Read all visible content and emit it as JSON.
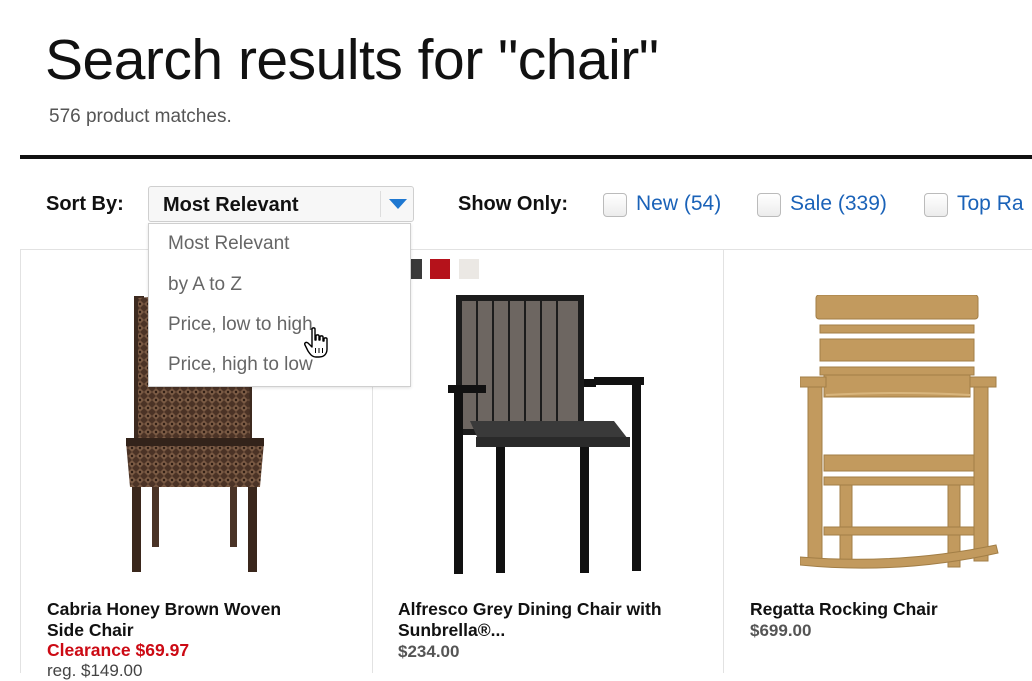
{
  "page": {
    "title": "Search results for \"chair\"",
    "match_count": "576 product matches."
  },
  "toolbar": {
    "sort_label": "Sort By:",
    "sort_selected": "Most Relevant",
    "sort_options": [
      "Most Relevant",
      "by A to Z",
      "Price, low to high",
      "Price, high to low"
    ],
    "show_label": "Show Only:",
    "filters": [
      {
        "label": "New (54)",
        "checked": false
      },
      {
        "label": "Sale (339)",
        "checked": false
      },
      {
        "label": "Top Ra",
        "checked": false
      }
    ]
  },
  "products": [
    {
      "name_line1": "Cabria Honey Brown Woven",
      "name_line2": "Side Chair",
      "clearance": "Clearance $69.97",
      "reg_price": "reg. $149.00"
    },
    {
      "name_line1": "Alfresco Grey Dining Chair with",
      "name_line2": "Sunbrella®...",
      "price": "$234.00",
      "swatch_colors": [
        "#3a3a3a",
        "#b5121b",
        "#ebe8e4"
      ]
    },
    {
      "name_line1": "Regatta Rocking Chair",
      "price": "$699.00"
    }
  ],
  "colors": {
    "link": "#1a62b8",
    "clearance": "#cc0a14",
    "sort_arrow": "#1f78d1"
  }
}
